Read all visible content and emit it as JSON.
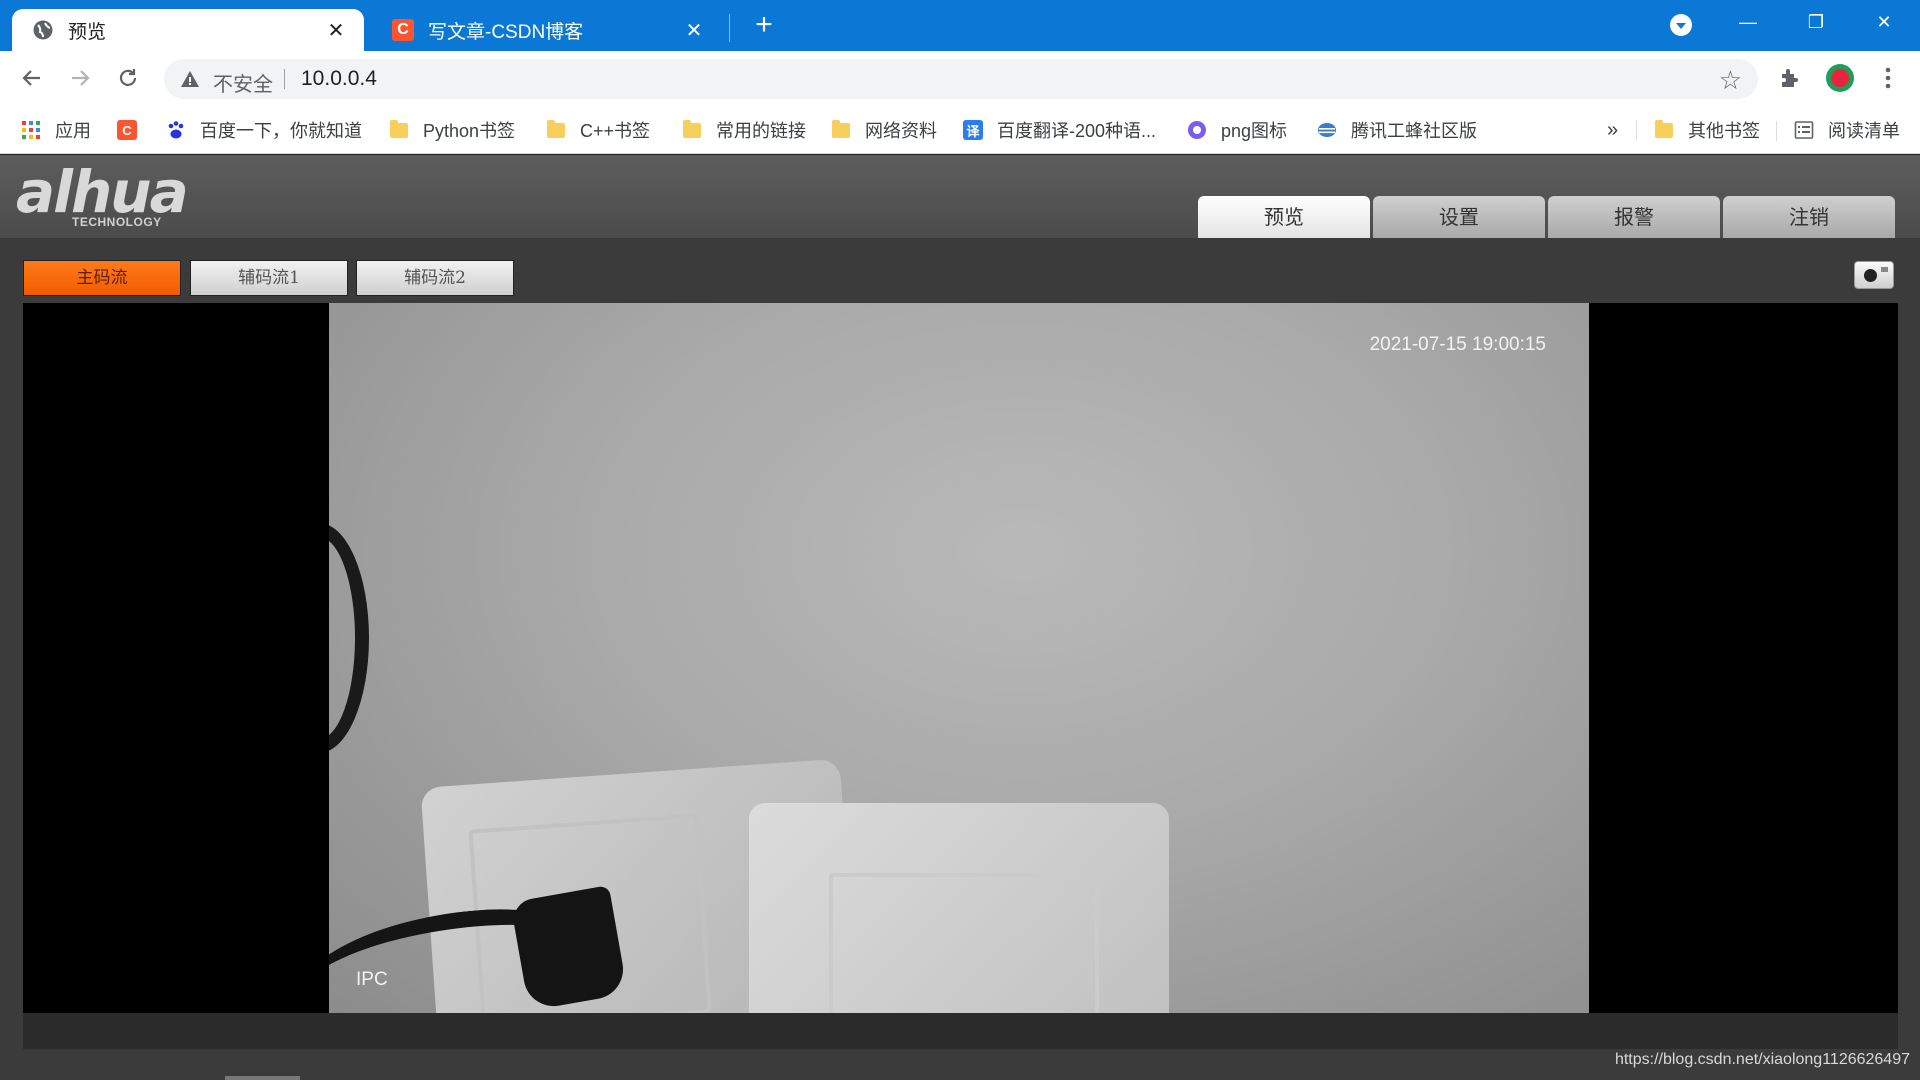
{
  "browser": {
    "tabs": [
      {
        "title": "预览",
        "icon": "globe-icon"
      },
      {
        "title": "写文章-CSDN博客",
        "icon": "csdn-icon",
        "favicon_letter": "C"
      }
    ],
    "new_tab": "+",
    "window_controls": {
      "minimize": "—",
      "restore": "❐",
      "close": "✕"
    },
    "address": {
      "security_label": "不安全",
      "url": "10.0.0.4"
    },
    "bookmarks": [
      {
        "label": "应用",
        "icon": "apps-grid-icon"
      },
      {
        "label": "",
        "icon": "csdn-icon",
        "letter": "C"
      },
      {
        "label": "百度一下，你就知道",
        "icon": "baidu-paw-icon"
      },
      {
        "label": "Python书签",
        "icon": "folder-icon"
      },
      {
        "label": "C++书签",
        "icon": "folder-icon"
      },
      {
        "label": "常用的链接",
        "icon": "folder-icon"
      },
      {
        "label": "网络资料",
        "icon": "folder-icon"
      },
      {
        "label": "百度翻译-200种语...",
        "icon": "translate-icon",
        "letter": "译"
      },
      {
        "label": "png图标",
        "icon": "png-circle-icon"
      },
      {
        "label": "腾讯工蜂社区版",
        "icon": "tencent-bee-icon"
      }
    ],
    "more": "»",
    "other_bookmarks": "其他书签",
    "reading_list": "阅读清单"
  },
  "app": {
    "logo": {
      "brand": "alhua",
      "tagline": "TECHNOLOGY"
    },
    "nav": [
      "预览",
      "设置",
      "报警",
      "注销"
    ],
    "active_nav": 0,
    "streams": [
      "主码流",
      "辅码流1",
      "辅码流2"
    ],
    "active_stream": 0,
    "video": {
      "timestamp": "2021-07-15 19:00:15",
      "channel": "IPC"
    }
  },
  "watermark": "https://blog.csdn.net/xiaolong1126626497",
  "colors": {
    "chrome_blue": "#0b78d6",
    "stream_active": "#f25c00",
    "page_bg": "#3b3b3b"
  }
}
